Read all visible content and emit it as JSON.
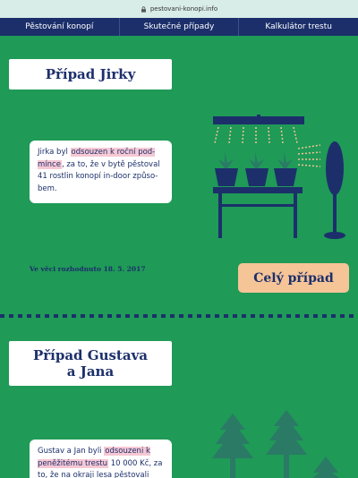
{
  "browser": {
    "url": "pestovani-konopi.info"
  },
  "nav": {
    "items": [
      {
        "label": "Pěstování konopí"
      },
      {
        "label": "Skutečné případy"
      },
      {
        "label": "Kalkulátor trestu"
      }
    ]
  },
  "cases": [
    {
      "title": "Případ Jirky",
      "text_pre": "Jirka byl ",
      "text_highlight": "odsouzen k roční pod-mínce",
      "text_post": ", za to, že v bytě pěstoval 41 rostlin konopí in-door způso-bem.",
      "decided": "Ve věci rozhodnuto 18. 5. 2017",
      "button_label": "Celý případ"
    },
    {
      "title": "Případ Gustava a Jana",
      "text_pre": "Gustav a Jan byli ",
      "text_highlight": "odsouzeni k peněžitému trestu",
      "text_post": " 10 000 Kč, za to, že na okraji lesa pěstovali"
    }
  ],
  "colors": {
    "background": "#1f9a57",
    "navy": "#1c2f6b",
    "highlight": "#f6c8d4",
    "button": "#f5c497",
    "tree": "#2a7a66"
  }
}
